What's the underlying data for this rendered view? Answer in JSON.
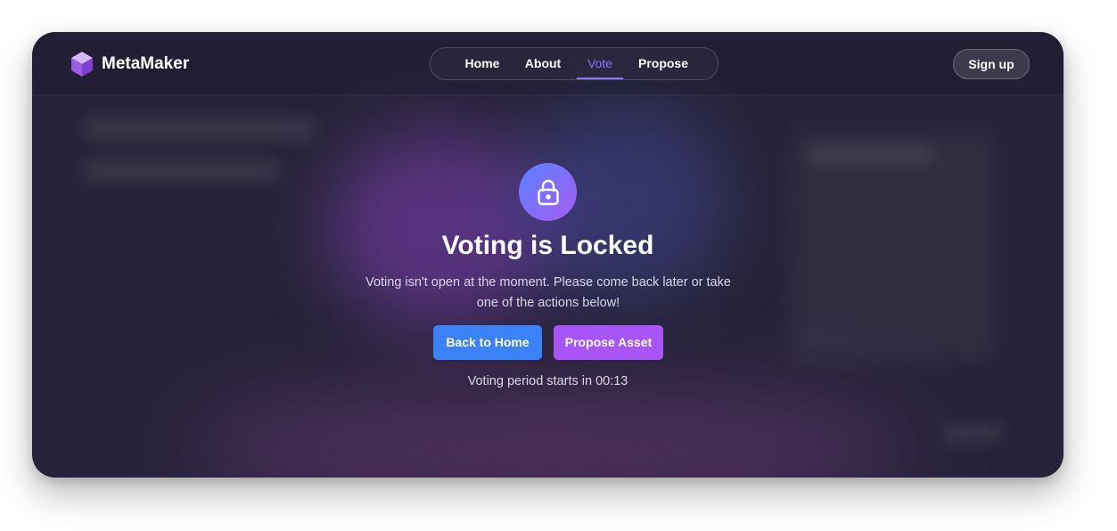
{
  "brand": {
    "name": "MetaMaker",
    "icon": "cube-icon"
  },
  "nav": {
    "items": [
      {
        "label": "Home"
      },
      {
        "label": "About"
      },
      {
        "label": "Vote"
      },
      {
        "label": "Propose"
      }
    ],
    "active": "Vote",
    "signup_label": "Sign up"
  },
  "locked": {
    "icon": "lock-icon",
    "title": "Voting is Locked",
    "description": "Voting isn't open at the moment. Please come back later or take one of the actions below!",
    "buttons": {
      "home": "Back to Home",
      "propose": "Propose Asset"
    },
    "countdown": "Voting period starts in 00:13"
  },
  "colors": {
    "accent": "#8b74ff",
    "home_button": "#3b82f6",
    "propose_button": "#a855f7",
    "background": "#262338"
  }
}
